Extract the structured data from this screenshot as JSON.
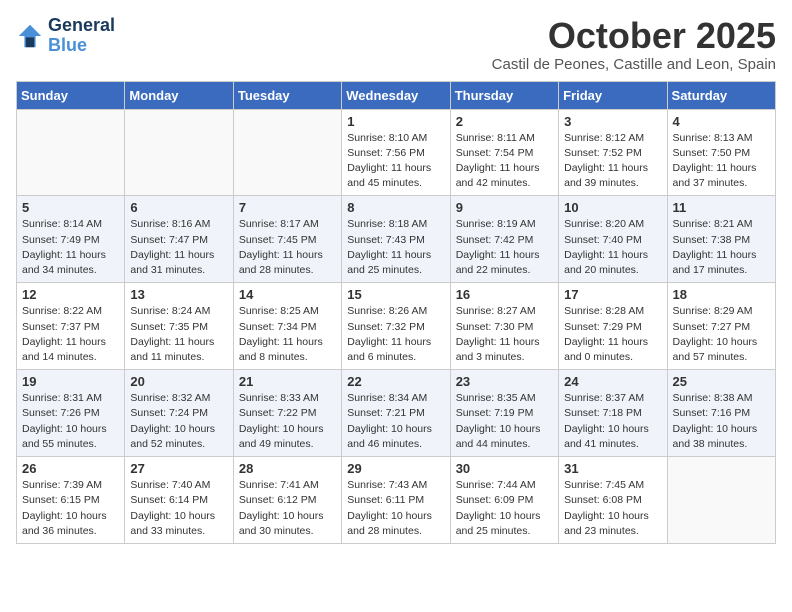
{
  "header": {
    "logo_line1": "General",
    "logo_line2": "Blue",
    "month": "October 2025",
    "location": "Castil de Peones, Castille and Leon, Spain"
  },
  "weekdays": [
    "Sunday",
    "Monday",
    "Tuesday",
    "Wednesday",
    "Thursday",
    "Friday",
    "Saturday"
  ],
  "weeks": [
    [
      {
        "day": "",
        "info": ""
      },
      {
        "day": "",
        "info": ""
      },
      {
        "day": "",
        "info": ""
      },
      {
        "day": "1",
        "info": "Sunrise: 8:10 AM\nSunset: 7:56 PM\nDaylight: 11 hours\nand 45 minutes."
      },
      {
        "day": "2",
        "info": "Sunrise: 8:11 AM\nSunset: 7:54 PM\nDaylight: 11 hours\nand 42 minutes."
      },
      {
        "day": "3",
        "info": "Sunrise: 8:12 AM\nSunset: 7:52 PM\nDaylight: 11 hours\nand 39 minutes."
      },
      {
        "day": "4",
        "info": "Sunrise: 8:13 AM\nSunset: 7:50 PM\nDaylight: 11 hours\nand 37 minutes."
      }
    ],
    [
      {
        "day": "5",
        "info": "Sunrise: 8:14 AM\nSunset: 7:49 PM\nDaylight: 11 hours\nand 34 minutes."
      },
      {
        "day": "6",
        "info": "Sunrise: 8:16 AM\nSunset: 7:47 PM\nDaylight: 11 hours\nand 31 minutes."
      },
      {
        "day": "7",
        "info": "Sunrise: 8:17 AM\nSunset: 7:45 PM\nDaylight: 11 hours\nand 28 minutes."
      },
      {
        "day": "8",
        "info": "Sunrise: 8:18 AM\nSunset: 7:43 PM\nDaylight: 11 hours\nand 25 minutes."
      },
      {
        "day": "9",
        "info": "Sunrise: 8:19 AM\nSunset: 7:42 PM\nDaylight: 11 hours\nand 22 minutes."
      },
      {
        "day": "10",
        "info": "Sunrise: 8:20 AM\nSunset: 7:40 PM\nDaylight: 11 hours\nand 20 minutes."
      },
      {
        "day": "11",
        "info": "Sunrise: 8:21 AM\nSunset: 7:38 PM\nDaylight: 11 hours\nand 17 minutes."
      }
    ],
    [
      {
        "day": "12",
        "info": "Sunrise: 8:22 AM\nSunset: 7:37 PM\nDaylight: 11 hours\nand 14 minutes."
      },
      {
        "day": "13",
        "info": "Sunrise: 8:24 AM\nSunset: 7:35 PM\nDaylight: 11 hours\nand 11 minutes."
      },
      {
        "day": "14",
        "info": "Sunrise: 8:25 AM\nSunset: 7:34 PM\nDaylight: 11 hours\nand 8 minutes."
      },
      {
        "day": "15",
        "info": "Sunrise: 8:26 AM\nSunset: 7:32 PM\nDaylight: 11 hours\nand 6 minutes."
      },
      {
        "day": "16",
        "info": "Sunrise: 8:27 AM\nSunset: 7:30 PM\nDaylight: 11 hours\nand 3 minutes."
      },
      {
        "day": "17",
        "info": "Sunrise: 8:28 AM\nSunset: 7:29 PM\nDaylight: 11 hours\nand 0 minutes."
      },
      {
        "day": "18",
        "info": "Sunrise: 8:29 AM\nSunset: 7:27 PM\nDaylight: 10 hours\nand 57 minutes."
      }
    ],
    [
      {
        "day": "19",
        "info": "Sunrise: 8:31 AM\nSunset: 7:26 PM\nDaylight: 10 hours\nand 55 minutes."
      },
      {
        "day": "20",
        "info": "Sunrise: 8:32 AM\nSunset: 7:24 PM\nDaylight: 10 hours\nand 52 minutes."
      },
      {
        "day": "21",
        "info": "Sunrise: 8:33 AM\nSunset: 7:22 PM\nDaylight: 10 hours\nand 49 minutes."
      },
      {
        "day": "22",
        "info": "Sunrise: 8:34 AM\nSunset: 7:21 PM\nDaylight: 10 hours\nand 46 minutes."
      },
      {
        "day": "23",
        "info": "Sunrise: 8:35 AM\nSunset: 7:19 PM\nDaylight: 10 hours\nand 44 minutes."
      },
      {
        "day": "24",
        "info": "Sunrise: 8:37 AM\nSunset: 7:18 PM\nDaylight: 10 hours\nand 41 minutes."
      },
      {
        "day": "25",
        "info": "Sunrise: 8:38 AM\nSunset: 7:16 PM\nDaylight: 10 hours\nand 38 minutes."
      }
    ],
    [
      {
        "day": "26",
        "info": "Sunrise: 7:39 AM\nSunset: 6:15 PM\nDaylight: 10 hours\nand 36 minutes."
      },
      {
        "day": "27",
        "info": "Sunrise: 7:40 AM\nSunset: 6:14 PM\nDaylight: 10 hours\nand 33 minutes."
      },
      {
        "day": "28",
        "info": "Sunrise: 7:41 AM\nSunset: 6:12 PM\nDaylight: 10 hours\nand 30 minutes."
      },
      {
        "day": "29",
        "info": "Sunrise: 7:43 AM\nSunset: 6:11 PM\nDaylight: 10 hours\nand 28 minutes."
      },
      {
        "day": "30",
        "info": "Sunrise: 7:44 AM\nSunset: 6:09 PM\nDaylight: 10 hours\nand 25 minutes."
      },
      {
        "day": "31",
        "info": "Sunrise: 7:45 AM\nSunset: 6:08 PM\nDaylight: 10 hours\nand 23 minutes."
      },
      {
        "day": "",
        "info": ""
      }
    ]
  ]
}
